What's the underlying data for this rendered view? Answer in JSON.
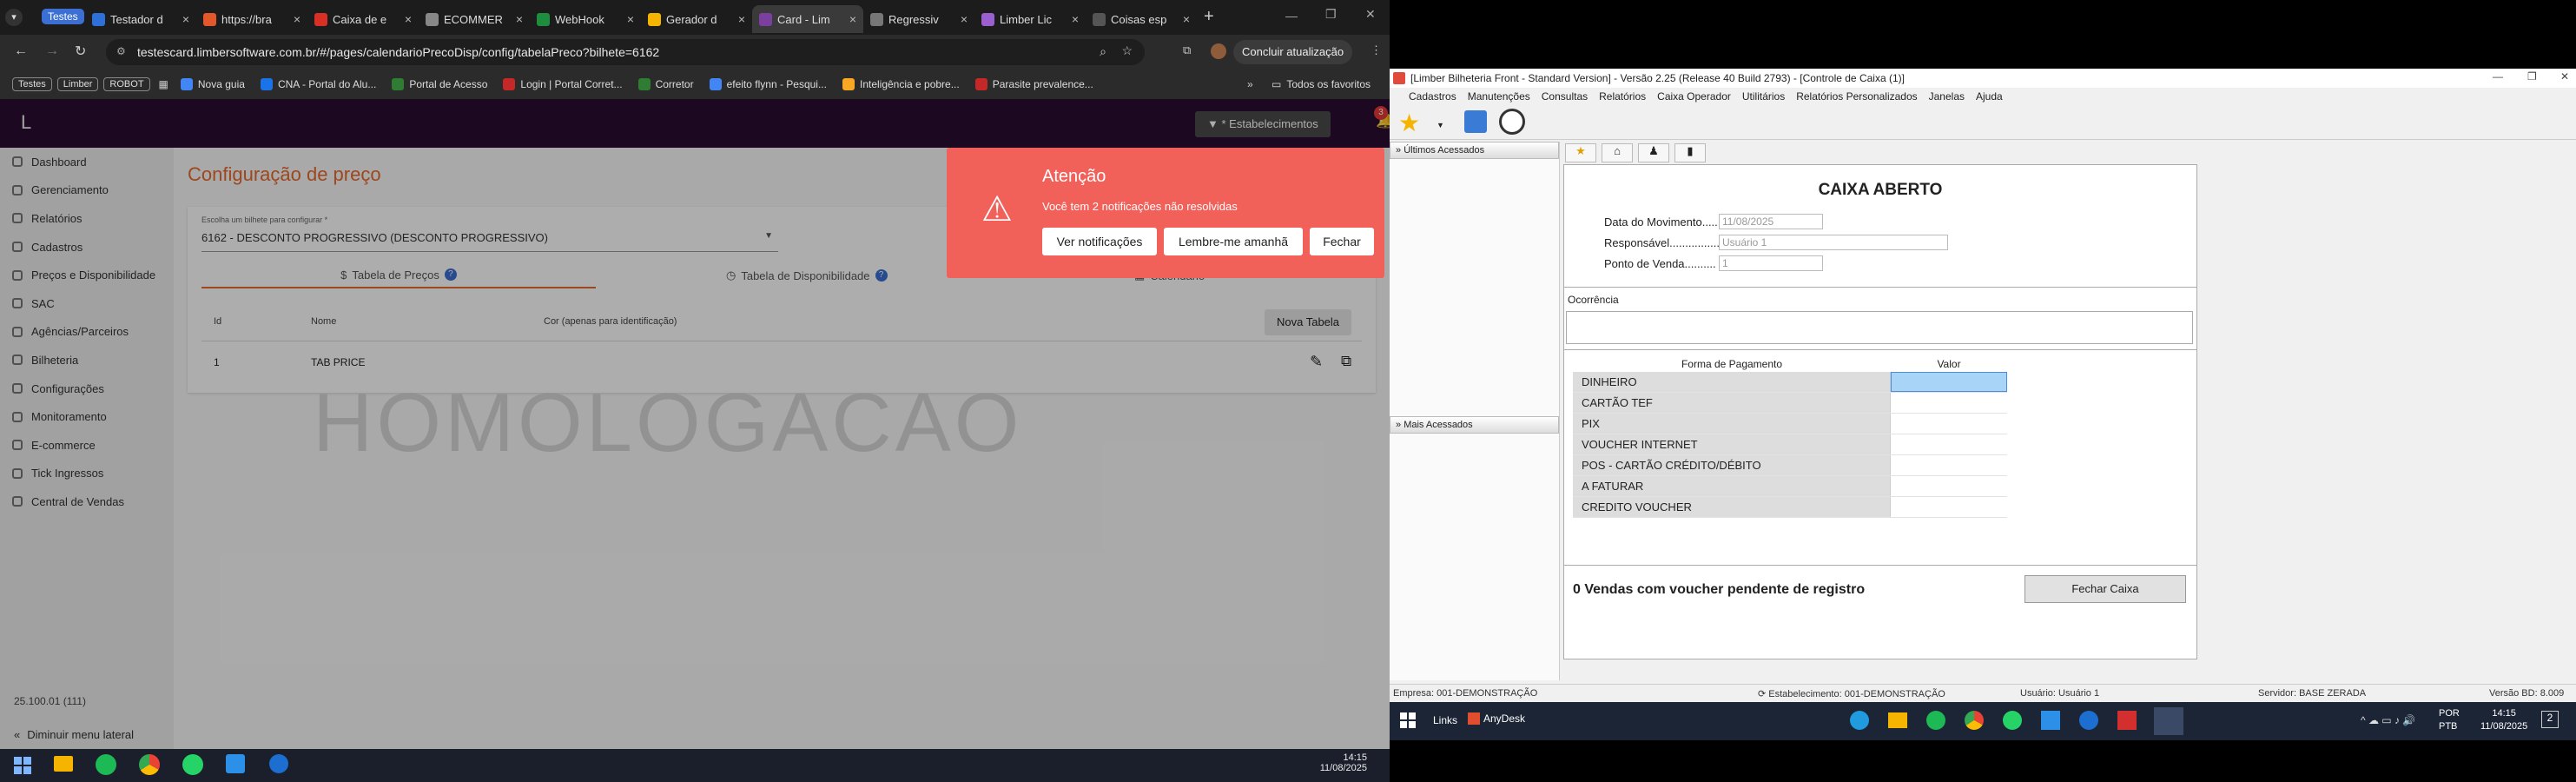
{
  "browser": {
    "group_label": "Testes",
    "tabs": [
      {
        "label": "Testador d",
        "color": "#2f6fda"
      },
      {
        "label": "https://bra",
        "color": "#e2572b"
      },
      {
        "label": "Caixa de e",
        "color": "#d93025"
      },
      {
        "label": "ECOMMER",
        "color": "#888888"
      },
      {
        "label": "WebHook",
        "color": "#1e8e3e"
      },
      {
        "label": "Gerador d",
        "color": "#f4b400"
      },
      {
        "label": "Card - Lim",
        "color": "#7b3fa0",
        "active": true
      },
      {
        "label": "Regressiv",
        "color": "#777777"
      },
      {
        "label": "Limber Lic",
        "color": "#9b5fd0"
      },
      {
        "label": "Coisas esp",
        "color": "#555555"
      }
    ],
    "new_tab": "+",
    "url": "testescard.limbersoftware.com.br/#/pages/calendarioPrecoDisp/config/tabelaPreco?bilhete=6162",
    "update_button": "Concluir atualização",
    "bookmark_chips": [
      "Testes",
      "Limber",
      "ROBOT"
    ],
    "bookmarks": [
      {
        "label": "Nova guia",
        "color": "#4285f4"
      },
      {
        "label": "CNA - Portal do Alu...",
        "color": "#1a73e8"
      },
      {
        "label": "Portal de Acesso",
        "color": "#2e7d32"
      },
      {
        "label": "Login | Portal Corret...",
        "color": "#c62828"
      },
      {
        "label": "Corretor",
        "color": "#2e7d32"
      },
      {
        "label": "efeito flynn - Pesqui...",
        "color": "#4285f4"
      },
      {
        "label": "Inteligência e pobre...",
        "color": "#f9a825"
      },
      {
        "label": "Parasite prevalence...",
        "color": "#c62828"
      }
    ],
    "all_favorites": "Todos os favoritos"
  },
  "app": {
    "logo": "L",
    "estab_button": "* Estabelecimentos",
    "notif_count": "3",
    "sidebar": [
      "Dashboard",
      "Gerenciamento",
      "Relatórios",
      "Cadastros",
      "Preços e Disponibilidade",
      "SAC",
      "Agências/Parceiros",
      "Bilheteria",
      "Configurações",
      "Monitoramento",
      "E-commerce",
      "Tick Ingressos",
      "Central de Vendas"
    ],
    "version": "25.100.01 (111)",
    "collapse_label": "Diminuir menu lateral",
    "page_title": "Configuração de preço",
    "select_label": "Escolha um bilhete para configurar *",
    "select_value": "6162 - DESCONTO PROGRESSIVO (DESCONTO PROGRESSIVO)",
    "tab_prices": "Tabela de Preços",
    "tab_avail": "Tabela de Disponibilidade",
    "tab_calendar": "Calendário",
    "table_headers": [
      "Id",
      "Nome",
      "Cor (apenas para identificação)"
    ],
    "new_table_button": "Nova Tabela",
    "rows": [
      {
        "id": "1",
        "name": "TAB PRICE"
      }
    ],
    "watermark": "HOMOLOGACAO"
  },
  "alert": {
    "title": "Atenção",
    "message": "Você tem 2 notificações não resolvidas",
    "btn_view": "Ver notificações",
    "btn_remind": "Lembre-me amanhã",
    "btn_close": "Fechar"
  },
  "taskbar_left": {
    "time": "14:15",
    "date": "11/08/2025"
  },
  "limber": {
    "title": "[Limber Bilheteria Front - Standard Version] - Versão 2.25 (Release 40 Build 2793) - [Controle de Caixa (1)]",
    "menu": [
      "Cadastros",
      "Manutenções",
      "Consultas",
      "Relatórios",
      "Caixa Operador",
      "Utilitários",
      "Relatórios Personalizados",
      "Janelas",
      "Ajuda"
    ],
    "recent_panel": "Últimos Acessados",
    "most_panel": "Mais Acessados",
    "header": "CAIXA ABERTO",
    "lbl_date": "Data do Movimento......",
    "val_date": "11/08/2025",
    "lbl_resp": "Responsável..................",
    "val_resp": "Usuário 1",
    "lbl_pdv": "Ponto de Venda..........",
    "val_pdv": "1",
    "occ_label": "Ocorrência",
    "grid_headers": [
      "Forma de Pagamento",
      "Valor"
    ],
    "payments": [
      "DINHEIRO",
      "CARTÃO TEF",
      "PIX",
      "VOUCHER INTERNET",
      "POS - CARTÃO CRÉDITO/DÉBITO",
      "A FATURAR",
      "CREDITO VOUCHER"
    ],
    "pending": "0 Vendas com voucher pendente de registro",
    "close_button": "Fechar Caixa",
    "status_empresa": "Empresa: 001-DEMONSTRAÇÃO",
    "status_estab": "Estabelecimento: 001-DEMONSTRAÇÃO",
    "status_user": "Usuário: Usuário 1",
    "status_server": "Servidor: BASE ZERADA",
    "status_version": "Versão BD: 8.009"
  },
  "taskbar_right": {
    "links": "Links",
    "anydesk": "AnyDesk",
    "lang1": "POR",
    "lang2": "PTB",
    "time": "14:15",
    "date": "11/08/2025",
    "notif": "2"
  }
}
